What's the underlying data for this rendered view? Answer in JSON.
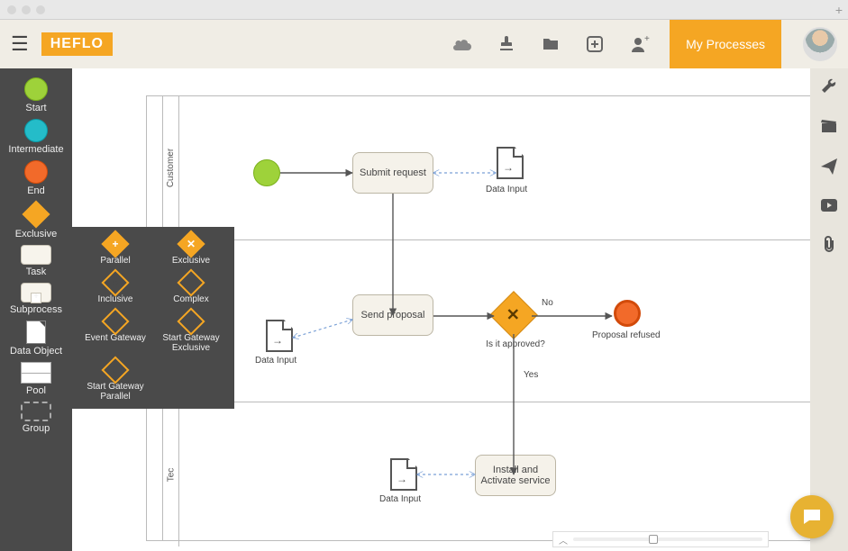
{
  "logo": "HEFLO",
  "header": {
    "my_processes": "My Processes"
  },
  "palette": [
    {
      "id": "start",
      "label": "Start"
    },
    {
      "id": "intermediate",
      "label": "Intermediate"
    },
    {
      "id": "end",
      "label": "End"
    },
    {
      "id": "exclusive",
      "label": "Exclusive"
    },
    {
      "id": "task",
      "label": "Task"
    },
    {
      "id": "subprocess",
      "label": "Subprocess"
    },
    {
      "id": "data-object",
      "label": "Data Object"
    },
    {
      "id": "pool",
      "label": "Pool"
    },
    {
      "id": "group",
      "label": "Group"
    }
  ],
  "gateway_flyout": [
    {
      "id": "parallel",
      "label": "Parallel",
      "glyph": "+"
    },
    {
      "id": "exclusive",
      "label": "Exclusive",
      "glyph": "✕"
    },
    {
      "id": "inclusive",
      "label": "Inclusive",
      "glyph": "○"
    },
    {
      "id": "complex",
      "label": "Complex",
      "glyph": "✱"
    },
    {
      "id": "event-gateway",
      "label": "Event Gateway",
      "glyph": "◎"
    },
    {
      "id": "start-gateway-exclusive",
      "label": "Start Gateway Exclusive",
      "glyph": "◎"
    },
    {
      "id": "start-gateway-parallel",
      "label": "Start Gateway Parallel",
      "glyph": "⊕"
    }
  ],
  "diagram": {
    "lanes": [
      "Customer",
      "",
      "Tec"
    ],
    "nodes": {
      "start": {
        "type": "start"
      },
      "submit": {
        "type": "task",
        "label": "Submit request"
      },
      "din1": {
        "type": "data",
        "label": "Data Input"
      },
      "din2": {
        "type": "data",
        "label": "Data Input"
      },
      "send": {
        "type": "task",
        "label": "Send proposal"
      },
      "gw": {
        "type": "gateway",
        "label": "Is it approved?",
        "glyph": "✕"
      },
      "end": {
        "type": "end",
        "label": "Proposal refused"
      },
      "din3": {
        "type": "data",
        "label": "Data Input"
      },
      "install": {
        "type": "task",
        "label": "Install and Activate service"
      }
    },
    "edge_labels": {
      "no": "No",
      "yes": "Yes"
    }
  },
  "chart_data": {
    "type": "diagram",
    "notation": "BPMN",
    "pool": {
      "lanes": [
        "Customer",
        "",
        "Tec"
      ]
    },
    "nodes": [
      {
        "id": "start",
        "type": "startEvent",
        "lane": 0
      },
      {
        "id": "submit",
        "type": "task",
        "label": "Submit request",
        "lane": 0
      },
      {
        "id": "din1",
        "type": "dataInput",
        "label": "Data Input",
        "lane": 0
      },
      {
        "id": "din2",
        "type": "dataInput",
        "label": "Data Input",
        "lane": 1
      },
      {
        "id": "send",
        "type": "task",
        "label": "Send proposal",
        "lane": 1
      },
      {
        "id": "gw",
        "type": "exclusiveGateway",
        "label": "Is it approved?",
        "lane": 1
      },
      {
        "id": "end",
        "type": "endEvent",
        "label": "Proposal refused",
        "lane": 1
      },
      {
        "id": "din3",
        "type": "dataInput",
        "label": "Data Input",
        "lane": 2
      },
      {
        "id": "install",
        "type": "task",
        "label": "Install and Activate service",
        "lane": 2
      }
    ],
    "sequence_flows": [
      {
        "from": "start",
        "to": "submit"
      },
      {
        "from": "submit",
        "to": "send"
      },
      {
        "from": "send",
        "to": "gw"
      },
      {
        "from": "gw",
        "to": "end",
        "label": "No"
      },
      {
        "from": "gw",
        "to": "install",
        "label": "Yes"
      }
    ],
    "data_associations": [
      {
        "from": "din1",
        "to": "submit"
      },
      {
        "from": "din2",
        "to": "send"
      },
      {
        "from": "din3",
        "to": "install"
      }
    ]
  }
}
